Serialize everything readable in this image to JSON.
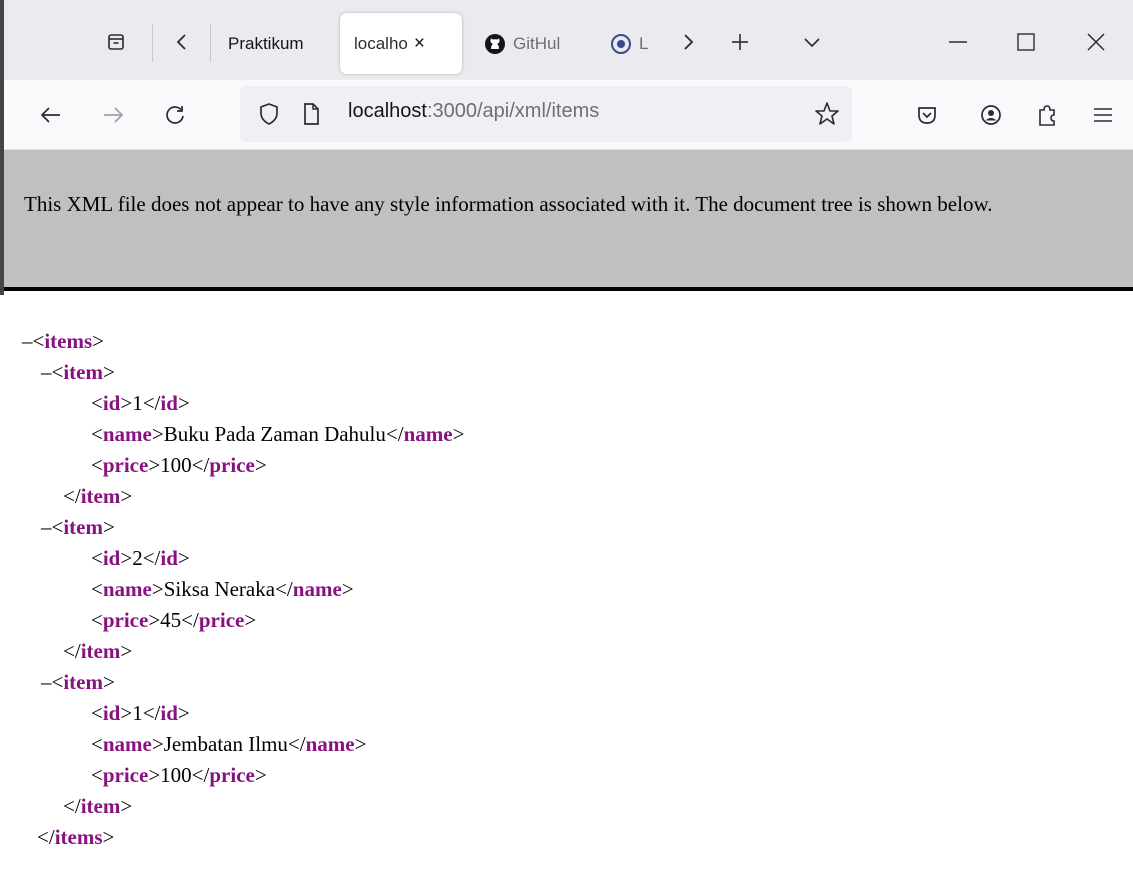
{
  "tabs": [
    {
      "label": "Praktikum",
      "active": false
    },
    {
      "label": "localho",
      "active": true,
      "close": "×"
    },
    {
      "label": "GitHul",
      "active": false,
      "icon": "github-icon"
    },
    {
      "label": "L",
      "active": false,
      "icon": "site-favicon-icon"
    }
  ],
  "url": {
    "host": "localhost",
    "path": ":3000/api/xml/items"
  },
  "xml_banner": "This XML file does not appear to have any style information associated with it. The document tree is shown below.",
  "xml_tree": {
    "root_tag": "items",
    "item_tag": "item",
    "field_tags": {
      "id": "id",
      "name": "name",
      "price": "price"
    },
    "items": [
      {
        "id": "1",
        "name": "Buku Pada Zaman Dahulu",
        "price": "100"
      },
      {
        "id": "2",
        "name": "Siksa Neraka",
        "price": "45"
      },
      {
        "id": "1",
        "name": "Jembatan Ilmu",
        "price": "100"
      }
    ]
  },
  "colors": {
    "xml_tag": "#881280",
    "banner_bg": "#c0c0c0",
    "tabstrip_bg": "#ebebef"
  }
}
